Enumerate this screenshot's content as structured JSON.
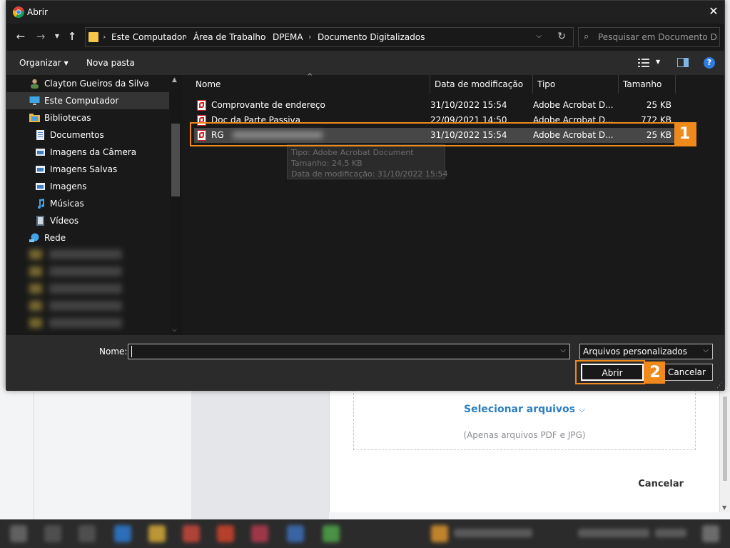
{
  "window": {
    "title": "Abrir"
  },
  "address": {
    "crumbs": [
      "Este Computador",
      "Área de Trabalho",
      "DPEMA",
      "Documento Digitalizados"
    ],
    "search_placeholder": "Pesquisar em Documento Di..."
  },
  "toolbar": {
    "organize_label": "Organizar",
    "new_folder_label": "Nova pasta"
  },
  "navigation": {
    "items": [
      {
        "label": "Clayton Gueiros da Silva",
        "icon": "user-folder-icon"
      },
      {
        "label": "Este Computador",
        "icon": "computer-icon",
        "selected": true
      },
      {
        "label": "Bibliotecas",
        "icon": "libraries-icon"
      },
      {
        "label": "Documentos",
        "icon": "documents-icon"
      },
      {
        "label": "Imagens da Câmera",
        "icon": "camera-roll-icon"
      },
      {
        "label": "Imagens Salvas",
        "icon": "saved-pictures-icon"
      },
      {
        "label": "Imagens",
        "icon": "pictures-icon"
      },
      {
        "label": "Músicas",
        "icon": "music-icon"
      },
      {
        "label": "Vídeos",
        "icon": "videos-icon"
      },
      {
        "label": "Rede",
        "icon": "network-icon"
      }
    ]
  },
  "file_list": {
    "columns": [
      "Nome",
      "Data de modificação",
      "Tipo",
      "Tamanho"
    ],
    "rows": [
      {
        "name": "Comprovante de endereço",
        "modified": "31/10/2022 15:54",
        "type": "Adobe Acrobat D...",
        "size": "25 KB",
        "selected": false
      },
      {
        "name": "Doc da Parte Passiva",
        "modified": "22/09/2021 14:50",
        "type": "Adobe Acrobat D...",
        "size": "772 KB",
        "selected": false
      },
      {
        "name": "RG",
        "modified": "31/10/2022 15:54",
        "type": "Adobe Acrobat D...",
        "size": "25 KB",
        "selected": true
      }
    ],
    "tooltip": [
      "Tipo: Adobe Acrobat Document",
      "Tamanho: 24,5 KB",
      "Data de modificação: 31/10/2022 15:54"
    ]
  },
  "footer": {
    "name_label": "Nome:",
    "name_value": "",
    "filter_value": "Arquivos personalizados",
    "open_label": "Abrir",
    "cancel_label": "Cancelar"
  },
  "annotations": {
    "step1": "1",
    "step2": "2",
    "color": "#f0891c"
  },
  "background_page": {
    "select_files_label": "Selecionar arquivos",
    "files_hint": "(Apenas arquivos PDF e JPG)",
    "cancel_label": "Cancelar"
  }
}
